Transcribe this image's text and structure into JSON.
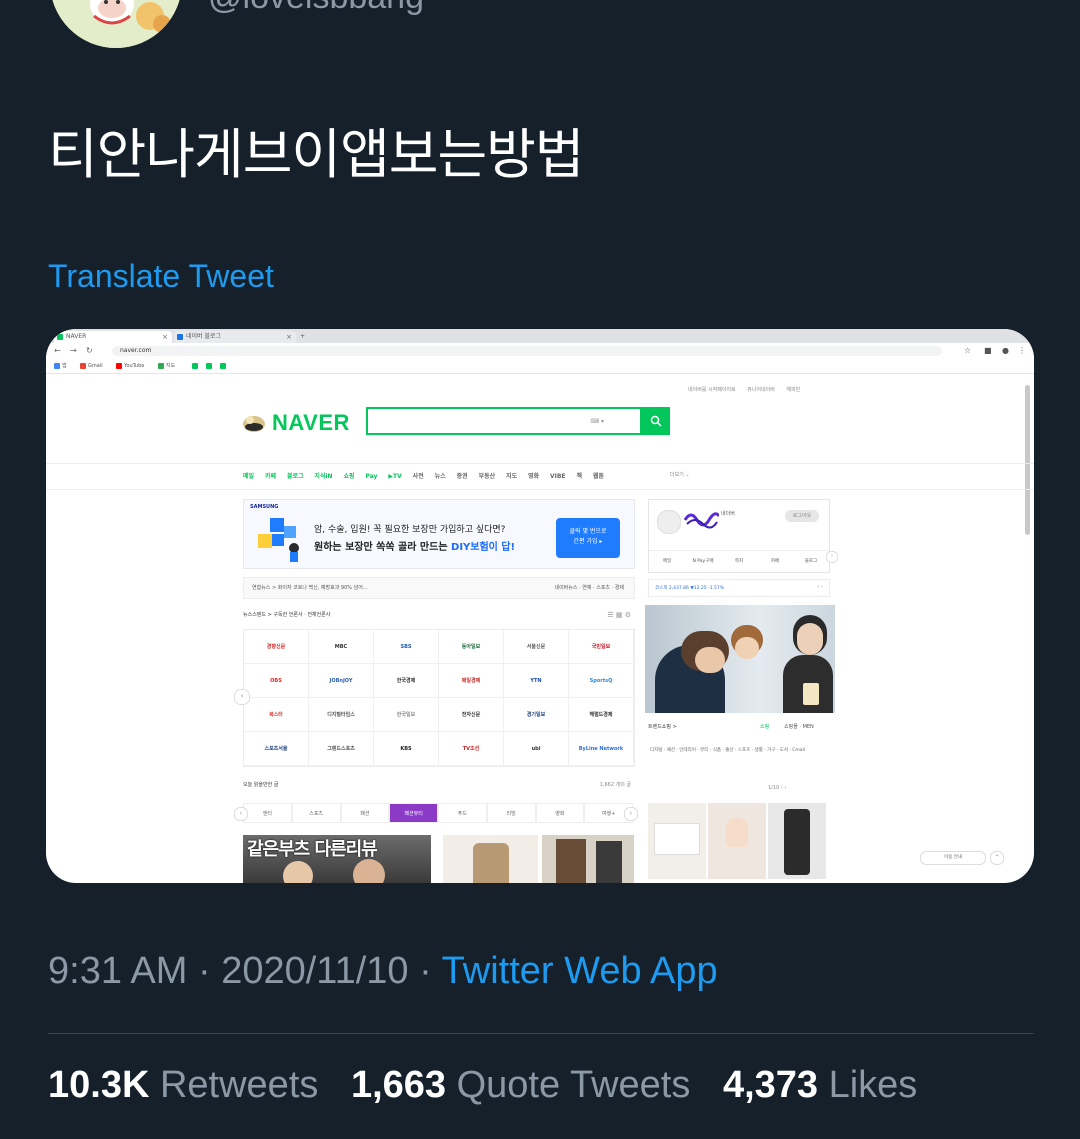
{
  "tweet": {
    "handle": "@lovelsbbang",
    "text": "티안나게브이앱보는방법",
    "translate_label": "Translate Tweet",
    "time": "9:31 AM",
    "date": "2020/11/10",
    "source": "Twitter Web App",
    "separator": "·"
  },
  "stats": {
    "retweets_count": "10.3K",
    "retweets_label": "Retweets",
    "quotes_count": "1,663",
    "quotes_label": "Quote Tweets",
    "likes_count": "4,373",
    "likes_label": "Likes"
  },
  "screenshot": {
    "tabs": [
      "NAVER",
      "네이버 블로그"
    ],
    "url": "naver.com",
    "bookmarks": [
      "앱",
      "Gmail",
      "YouTube",
      "지도"
    ],
    "top_links": [
      "네이버를 시작페이지로",
      "쥬니어네이버",
      "해피빈"
    ],
    "logo": "NAVER",
    "gnb": [
      "메일",
      "카페",
      "블로그",
      "지식iN",
      "쇼핑",
      "Pay",
      "▶TV",
      "사전",
      "뉴스",
      "증권",
      "부동산",
      "지도",
      "영화",
      "VIBE",
      "책",
      "웹툰"
    ],
    "gnb_more": "더보기",
    "ad": {
      "brand": "SAMSUNG",
      "line1": "암, 수술, 입원! 꼭 필요한 보장만 가입하고 싶다면?",
      "line2_pre": "원하는 보장만 쏙쏙 골라 만드는 ",
      "line2_hl": "DIY보험이 답!",
      "button": "클릭 몇 번으로\n간편 가입 ▸"
    },
    "news_bar_left": "연합뉴스 > 화이자 코로나 백신, 예방효과 90% 넘어...",
    "news_bar_right": "네이버뉴스 · 연예 · 스포츠 · 경제",
    "newsstand_label": "뉴스스탠드 > 구독한 언론사 · 전체언론사",
    "press": [
      "경향신문",
      "MBC",
      "SBS",
      "동아일보",
      "서울신문",
      "국민일보",
      "OBS",
      "JOBnJOY",
      "한국경제",
      "매일경제",
      "YTN",
      "SportsQ",
      "북스타",
      "디지털타임스",
      "한국일보",
      "전자신문",
      "경기일보",
      "헤럴드경제",
      "스포츠서울",
      "그랜드스포츠",
      "KBS",
      "TV조선",
      "ubi",
      "ByLine Network"
    ],
    "today_label": "오늘 읽을만한 글",
    "today_right": "1,662 개의 글",
    "categories": [
      "엔터",
      "스포츠",
      "패션",
      "패션뷰티",
      "푸드",
      "리빙",
      "영화",
      "여행+"
    ],
    "thumb_text": "같은부츠 다른리뷰",
    "stock": "코스피 2,437.86 ▼12.25 -1.57%",
    "shopping_label": "트렌드쇼핑 >",
    "shopping_tab1": "쇼핑",
    "shopping_tab2": "쇼핑몰 · MEN",
    "shopping_cats": "디지털 · 패션 · 인테리어 · 뷰티 · 식품 · 출산 · 스포츠 · 생활 · 가구 · 도서 · Cmall",
    "shopping_page": "1/10",
    "bottom_pill": "이용 안내",
    "login": {
      "name": "네이버",
      "pill": "로그아웃",
      "items": [
        "메일",
        "N Pay구매",
        "쪽지",
        "카페",
        "블로그"
      ]
    }
  },
  "colors": {
    "bg": "#15202b",
    "accent": "#1d9bf0",
    "muted": "#8b98a5",
    "naver_green": "#03c75a"
  }
}
